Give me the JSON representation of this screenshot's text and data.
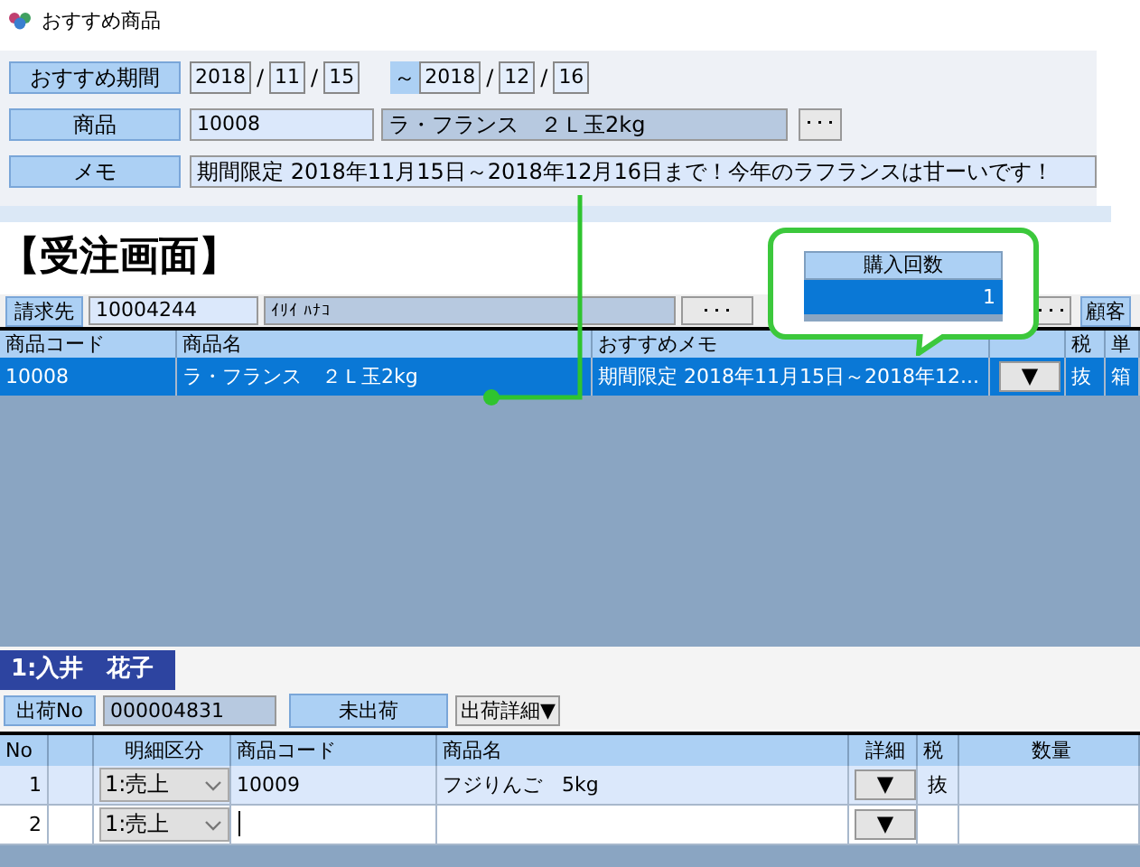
{
  "window": {
    "title": "おすすめ商品"
  },
  "recommendation": {
    "period_label": "おすすめ期間",
    "start_date": {
      "year": "2018",
      "sep1": "/",
      "month": "11",
      "sep2": "/",
      "day": "15"
    },
    "range_mark": "～",
    "end_date": {
      "year": "2018",
      "sep1": "/",
      "month": "12",
      "sep2": "/",
      "day": "16"
    },
    "product_label": "商品",
    "product_code": "10008",
    "product_name": "ラ・フランス　２Ｌ玉2kg",
    "lookup_button": "･･･",
    "memo_label": "メモ",
    "memo": "期間限定 2018年11月15日～2018年12月16日まで！今年のラフランスは甘ーいです！"
  },
  "order": {
    "heading": "【受注画面】",
    "billing_label": "請求先",
    "billing_code": "10004244",
    "billing_kana": "ｲﾘｲ ﾊﾅｺ",
    "lookup_button": "･･･",
    "lookup_button_2": "･･･",
    "customer_label": "顧客",
    "columns": [
      "商品コード",
      "商品名",
      "おすすめメモ",
      "税",
      "単"
    ],
    "rows": [
      {
        "selected": true,
        "cells": [
          "10008",
          "ラ・フランス　２Ｌ玉2kg",
          "期間限定 2018年11月15日～2018年12...",
          "抜",
          "箱"
        ],
        "detail": "▼"
      }
    ]
  },
  "callout": {
    "header": "購入回数",
    "value": "1"
  },
  "tabs": [
    {
      "label": "1:入井　花子",
      "selected": true
    }
  ],
  "shipment": {
    "label": "出荷No",
    "number": "000004831",
    "status": "未出荷",
    "detail_button": "出荷詳細▼"
  },
  "lines": {
    "columns": [
      "No",
      "明細区分",
      "商品コード",
      "商品名",
      "詳細",
      "税",
      "数量"
    ],
    "rows": [
      {
        "no": "1",
        "type": "1:売上",
        "code": "10009",
        "name": "フジりんご　5kg",
        "detail": "▼",
        "tax": "抜",
        "focused": false
      },
      {
        "no": "2",
        "type": "1:売上",
        "code": "",
        "detail": "▼",
        "focused": true
      }
    ]
  }
}
